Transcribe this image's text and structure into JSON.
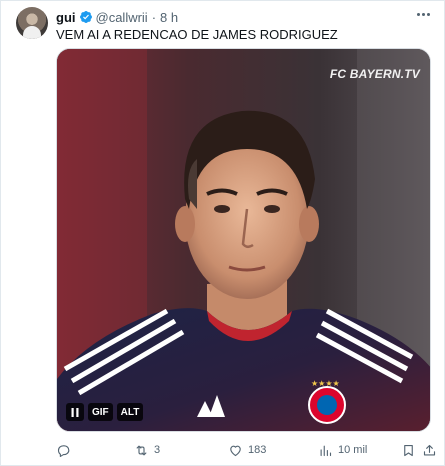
{
  "tweet": {
    "name": "gui",
    "handle": "@callwrii",
    "separator": "·",
    "time": "8 h",
    "text": "VEM AI A REDENCAO DE JAMES RODRIGUEZ"
  },
  "media": {
    "watermark": "FC BAYERN.TV",
    "pause_icon": "pause-icon",
    "gif_label": "GIF",
    "alt_label": "ALT"
  },
  "actions": {
    "replies": "",
    "retweets": "3",
    "likes": "183",
    "views": "10 mil"
  },
  "colors": {
    "text_primary": "#0f1419",
    "text_secondary": "#536471",
    "verified_blue": "#1d9bf0",
    "border": "#e1e8ed"
  }
}
